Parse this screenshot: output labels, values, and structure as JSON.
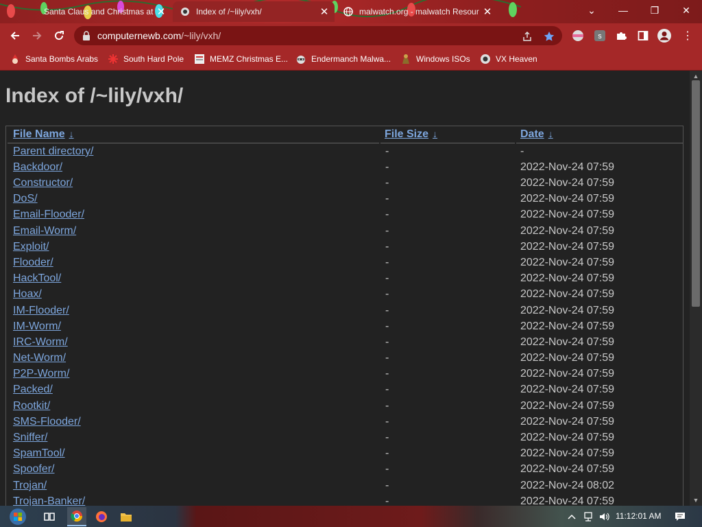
{
  "browser": {
    "tabs": [
      {
        "title": "Santa Claus and Christmas at the",
        "favicon": "santa-icon",
        "active": false
      },
      {
        "title": "Index of /~lily/vxh/",
        "favicon": "site-icon",
        "active": true
      },
      {
        "title": "malwatch.org - malwatch Resour",
        "favicon": "globe-icon",
        "active": false
      }
    ],
    "url_host": "computernewb.com",
    "url_path": "/~lily/vxh/",
    "bookmarks": [
      {
        "label": "Santa Bombs Arabs",
        "icon": "santa-icon"
      },
      {
        "label": "South Hard Pole",
        "icon": "snowflake-icon"
      },
      {
        "label": "MEMZ Christmas E...",
        "icon": "page-icon"
      },
      {
        "label": "Endermanch Malwa...",
        "icon": "raccoon-icon"
      },
      {
        "label": "Windows ISOs",
        "icon": "figure-icon"
      },
      {
        "label": "VX Heaven",
        "icon": "site-icon"
      }
    ],
    "theme_color": "#a52828"
  },
  "page": {
    "title": "Index of /~lily/vxh/",
    "columns": {
      "name": "File Name",
      "size": "File Size",
      "date": "Date",
      "sort_arrow": "↓"
    },
    "rows": [
      {
        "name": "Parent directory/",
        "size": "-",
        "date": "-"
      },
      {
        "name": "Backdoor/",
        "size": "-",
        "date": "2022-Nov-24 07:59"
      },
      {
        "name": "Constructor/",
        "size": "-",
        "date": "2022-Nov-24 07:59"
      },
      {
        "name": "DoS/",
        "size": "-",
        "date": "2022-Nov-24 07:59"
      },
      {
        "name": "Email-Flooder/",
        "size": "-",
        "date": "2022-Nov-24 07:59"
      },
      {
        "name": "Email-Worm/",
        "size": "-",
        "date": "2022-Nov-24 07:59"
      },
      {
        "name": "Exploit/",
        "size": "-",
        "date": "2022-Nov-24 07:59"
      },
      {
        "name": "Flooder/",
        "size": "-",
        "date": "2022-Nov-24 07:59"
      },
      {
        "name": "HackTool/",
        "size": "-",
        "date": "2022-Nov-24 07:59"
      },
      {
        "name": "Hoax/",
        "size": "-",
        "date": "2022-Nov-24 07:59"
      },
      {
        "name": "IM-Flooder/",
        "size": "-",
        "date": "2022-Nov-24 07:59"
      },
      {
        "name": "IM-Worm/",
        "size": "-",
        "date": "2022-Nov-24 07:59"
      },
      {
        "name": "IRC-Worm/",
        "size": "-",
        "date": "2022-Nov-24 07:59"
      },
      {
        "name": "Net-Worm/",
        "size": "-",
        "date": "2022-Nov-24 07:59"
      },
      {
        "name": "P2P-Worm/",
        "size": "-",
        "date": "2022-Nov-24 07:59"
      },
      {
        "name": "Packed/",
        "size": "-",
        "date": "2022-Nov-24 07:59"
      },
      {
        "name": "Rootkit/",
        "size": "-",
        "date": "2022-Nov-24 07:59"
      },
      {
        "name": "SMS-Flooder/",
        "size": "-",
        "date": "2022-Nov-24 07:59"
      },
      {
        "name": "Sniffer/",
        "size": "-",
        "date": "2022-Nov-24 07:59"
      },
      {
        "name": "SpamTool/",
        "size": "-",
        "date": "2022-Nov-24 07:59"
      },
      {
        "name": "Spoofer/",
        "size": "-",
        "date": "2022-Nov-24 07:59"
      },
      {
        "name": "Trojan/",
        "size": "-",
        "date": "2022-Nov-24 08:02"
      },
      {
        "name": "Trojan-Banker/",
        "size": "-",
        "date": "2022-Nov-24 07:59"
      }
    ]
  },
  "taskbar": {
    "clock": "11:12:01 AM",
    "apps": [
      "start-orb-icon",
      "task-view-icon",
      "chrome-icon",
      "firefox-icon",
      "file-explorer-icon"
    ]
  }
}
